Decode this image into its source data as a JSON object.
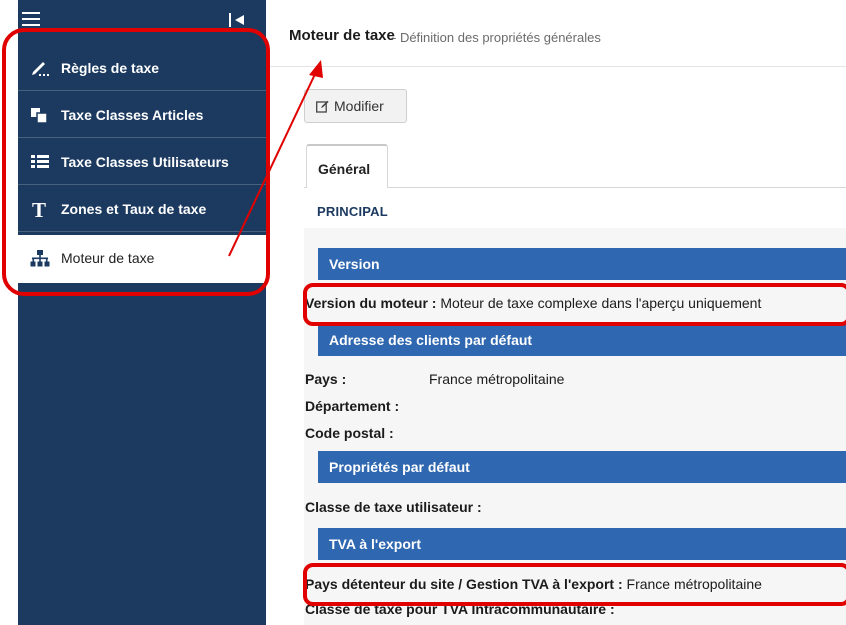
{
  "sidebar": {
    "items": [
      {
        "label": "Règles de taxe",
        "icon": "pencil-icon"
      },
      {
        "label": "Taxe Classes Articles",
        "icon": "copy-icon"
      },
      {
        "label": "Taxe Classes Utilisateurs",
        "icon": "list-icon"
      },
      {
        "label": "Zones et Taux de taxe",
        "icon": "text-t-icon"
      },
      {
        "label": "Moteur de taxe",
        "icon": "sitemap-icon",
        "active": true
      }
    ]
  },
  "header": {
    "title": "Moteur de taxe",
    "subtitle": "- Définition des propriétés générales"
  },
  "toolbar": {
    "modify_label": "Modifier"
  },
  "tabs": [
    {
      "label": "Général",
      "active": true
    }
  ],
  "section": {
    "title": "PRINCIPAL"
  },
  "groups": {
    "version": {
      "title": "Version",
      "fields": [
        {
          "label": "Version du moteur :",
          "value": "Moteur de taxe complexe dans l'aperçu uniquement"
        }
      ]
    },
    "address": {
      "title": "Adresse des clients par défaut",
      "fields": [
        {
          "label": "Pays :",
          "value": "France métropolitaine"
        },
        {
          "label": "Département :",
          "value": ""
        },
        {
          "label": "Code postal :",
          "value": ""
        }
      ]
    },
    "defaults": {
      "title": "Propriétés par défaut",
      "fields": [
        {
          "label": "Classe de taxe utilisateur :",
          "value": ""
        }
      ]
    },
    "export": {
      "title": "TVA à l'export",
      "fields": [
        {
          "label": "Pays détenteur du site / Gestion TVA à l'export :",
          "value": "France métropolitaine"
        },
        {
          "label": "Classe de taxe pour TVA Intracommunautaire :",
          "value": ""
        }
      ]
    }
  },
  "colors": {
    "sidebar_bg": "#1c3a60",
    "group_header": "#2f67b0",
    "highlight": "#e00000"
  }
}
